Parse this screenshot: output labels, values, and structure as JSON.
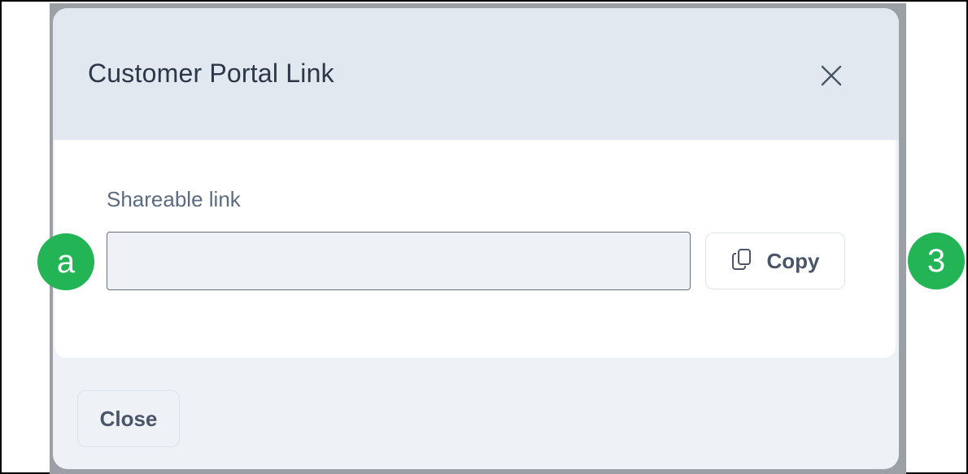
{
  "modal": {
    "title": "Customer Portal Link",
    "close_icon": "close-x-icon"
  },
  "body": {
    "field_label": "Shareable link",
    "link_value": "",
    "copy_label": "Copy",
    "copy_icon": "copy-icon"
  },
  "footer": {
    "close_label": "Close"
  },
  "markers": {
    "left": "a",
    "right": "3"
  },
  "colors": {
    "marker": "#22b455",
    "header": "#e2e8f0",
    "text": "#2d3748"
  }
}
